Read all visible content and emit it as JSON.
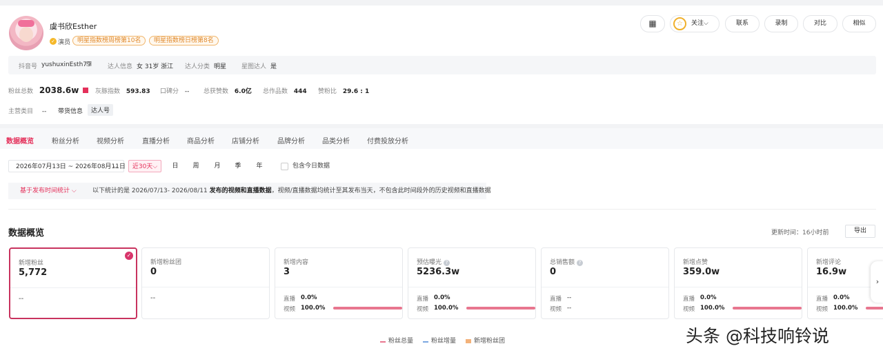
{
  "profile": {
    "name": "虞书欣Esther",
    "role": "演员",
    "ranks": [
      "明星指数榜周榜第10名",
      "明星指数榜日榜第8名"
    ]
  },
  "actions": {
    "follow": "关注",
    "contact": "联系",
    "record": "录制",
    "compare": "对比",
    "similar": "相似"
  },
  "info": {
    "douyin_label": "抖音号",
    "douyin_value": "yushuxinEsth79",
    "person_label": "达人信息",
    "person_value": "女 31岁 浙江",
    "category_label": "达人分类",
    "category_value": "明星",
    "xingtu_label": "星图达人",
    "xingtu_value": "是"
  },
  "stats": {
    "fans_label": "粉丝总数",
    "fans_value": "2038.6w",
    "index_label": "灰豚指数",
    "index_value": "593.83",
    "reputation_label": "口碑分",
    "reputation_value": "--",
    "likes_label": "总获赞数",
    "likes_value": "6.0亿",
    "works_label": "总作品数",
    "works_value": "444",
    "ratio_label": "赞粉比",
    "ratio_value": "29.6 : 1"
  },
  "extra": {
    "main_cat_label": "主营类目",
    "main_cat_value": "--",
    "goods_label": "带货信息",
    "goods_value": "达人号"
  },
  "tabs": [
    "数据概览",
    "粉丝分析",
    "视频分析",
    "直播分析",
    "商品分析",
    "店铺分析",
    "品牌分析",
    "品类分析",
    "付费投放分析"
  ],
  "filters": {
    "date_range": "2026年07月13日 ~ 2026年08月11日",
    "selected_period": "近30天",
    "periods": [
      "日",
      "周",
      "月",
      "季",
      "年"
    ],
    "include_today": "包含今日数据"
  },
  "notice": {
    "dropdown": "基于发布时间统计",
    "text_prefix": "以下统计的是 2026/07/13- 2026/08/11 ",
    "text_bold": "发布的视频和直播数据",
    "text_suffix": "，视频/直播数据均统计至其发布当天，不包含此时间段外的历史视频和直播数据"
  },
  "overview": {
    "title": "数据概览",
    "updated_label": "更新时间：",
    "updated_value": "16小时前",
    "export": "导出"
  },
  "cards": [
    {
      "title": "新增粉丝",
      "value": "5,772",
      "dash": "--"
    },
    {
      "title": "新增粉丝团",
      "value": "0",
      "dash": "--"
    },
    {
      "title": "新增内容",
      "value": "3",
      "live_label": "直播",
      "live_value": "0.0%",
      "video_label": "视频",
      "video_value": "100.0%"
    },
    {
      "title": "预估曝光",
      "value": "5236.3w",
      "live_label": "直播",
      "live_value": "0.0%",
      "video_label": "视频",
      "video_value": "100.0%"
    },
    {
      "title": "总销售额",
      "value": "0",
      "live_label": "直播",
      "live_value": "--",
      "video_label": "视频",
      "video_value": "--"
    },
    {
      "title": "新增点赞",
      "value": "359.0w",
      "live_label": "直播",
      "live_value": "0.0%",
      "video_label": "视频",
      "video_value": "100.0%"
    },
    {
      "title": "新增评论",
      "value": "16.9w",
      "live_label": "直播",
      "live_value": "0.0%",
      "video_label": "视频",
      "video_value": "100.0%"
    }
  ],
  "legend": [
    "粉丝总量",
    "粉丝增量",
    "新增粉丝团"
  ],
  "watermark": "头条 @科技响铃说",
  "colors": {
    "accent": "#e4305a",
    "bar": "#e8768f",
    "selected_border": "#c8325e"
  }
}
